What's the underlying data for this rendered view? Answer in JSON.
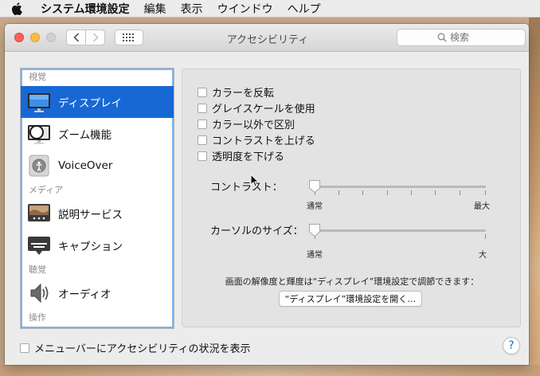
{
  "menubar": {
    "apple_icon": "apple-icon",
    "app_name": "システム環境設定",
    "items": [
      "編集",
      "表示",
      "ウインドウ",
      "ヘルプ"
    ]
  },
  "window": {
    "title": "アクセシビリティ",
    "search_placeholder": "検索"
  },
  "sidebar": {
    "sections": [
      {
        "label": "視覚",
        "items": [
          {
            "label": "ディスプレイ",
            "icon": "display-icon",
            "selected": true
          },
          {
            "label": "ズーム機能",
            "icon": "zoom-icon",
            "selected": false
          },
          {
            "label": "VoiceOver",
            "icon": "voiceover-icon",
            "selected": false
          }
        ]
      },
      {
        "label": "メディア",
        "items": [
          {
            "label": "説明サービス",
            "icon": "descriptions-icon",
            "selected": false
          },
          {
            "label": "キャプション",
            "icon": "captions-icon",
            "selected": false
          }
        ]
      },
      {
        "label": "聴覚",
        "items": [
          {
            "label": "オーディオ",
            "icon": "audio-icon",
            "selected": false
          }
        ]
      },
      {
        "label": "操作",
        "items": []
      }
    ]
  },
  "display": {
    "options": [
      {
        "label": "カラーを反転",
        "checked": false
      },
      {
        "label": "グレイスケールを使用",
        "checked": false
      },
      {
        "label": "カラー以外で区別",
        "checked": false
      },
      {
        "label": "コントラストを上げる",
        "checked": false
      },
      {
        "label": "透明度を下げる",
        "checked": false
      }
    ],
    "contrast": {
      "label": "コントラスト：",
      "min_label": "通常",
      "max_label": "最大",
      "value": 0
    },
    "cursor_size": {
      "label": "カーソルのサイズ：",
      "min_label": "通常",
      "max_label": "大",
      "value": 0
    },
    "note": "画面の解像度と輝度は“ディスプレイ”環境設定で調節できます：",
    "open_button": "“ディスプレイ”環境設定を開く…"
  },
  "footer": {
    "show_status_label": "メニューバーにアクセシビリティの状況を表示",
    "show_status_checked": false,
    "help_label": "?"
  },
  "colors": {
    "selection": "#1768d5",
    "close": "#fc605c",
    "minimize": "#fdbc40"
  }
}
